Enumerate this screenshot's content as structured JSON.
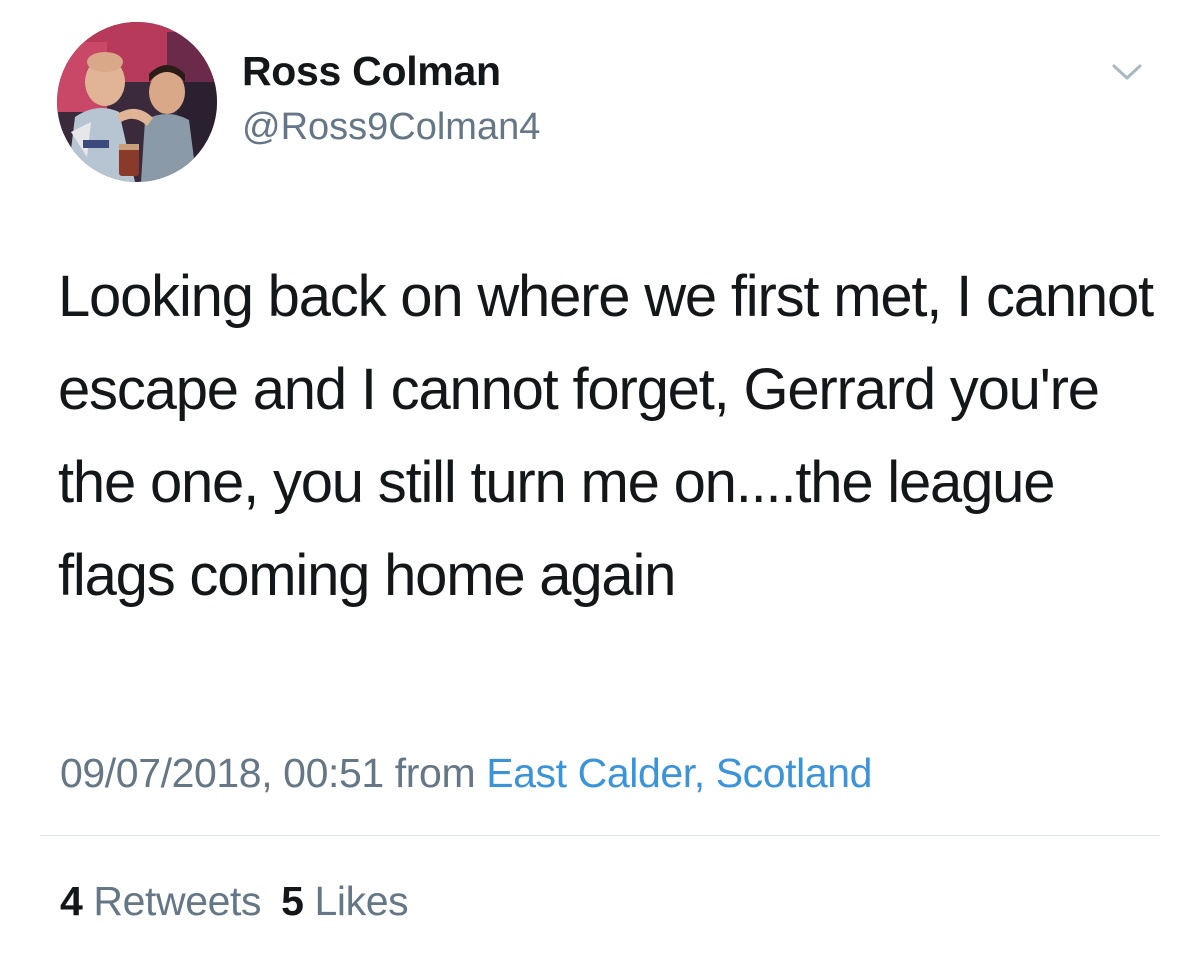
{
  "author": {
    "display_name": "Ross Colman",
    "handle": "@Ross9Colman4",
    "avatar_icon": "profile-photo"
  },
  "tweet": {
    "text": "Looking back on where we first met, I cannot escape and I cannot forget, Gerrard you're the one, you still turn me on....the league flags coming home again",
    "timestamp": "09/07/2018, 00:51",
    "from_label": "from",
    "location": "East Calder, Scotland"
  },
  "stats": {
    "retweets_count": "4",
    "retweets_label": "Retweets",
    "likes_count": "5",
    "likes_label": "Likes"
  },
  "menu": {
    "icon": "chevron-down-icon"
  },
  "colors": {
    "text_primary": "#14171a",
    "text_secondary": "#657786",
    "link": "#3b94d9",
    "divider": "#e1e8ed"
  }
}
